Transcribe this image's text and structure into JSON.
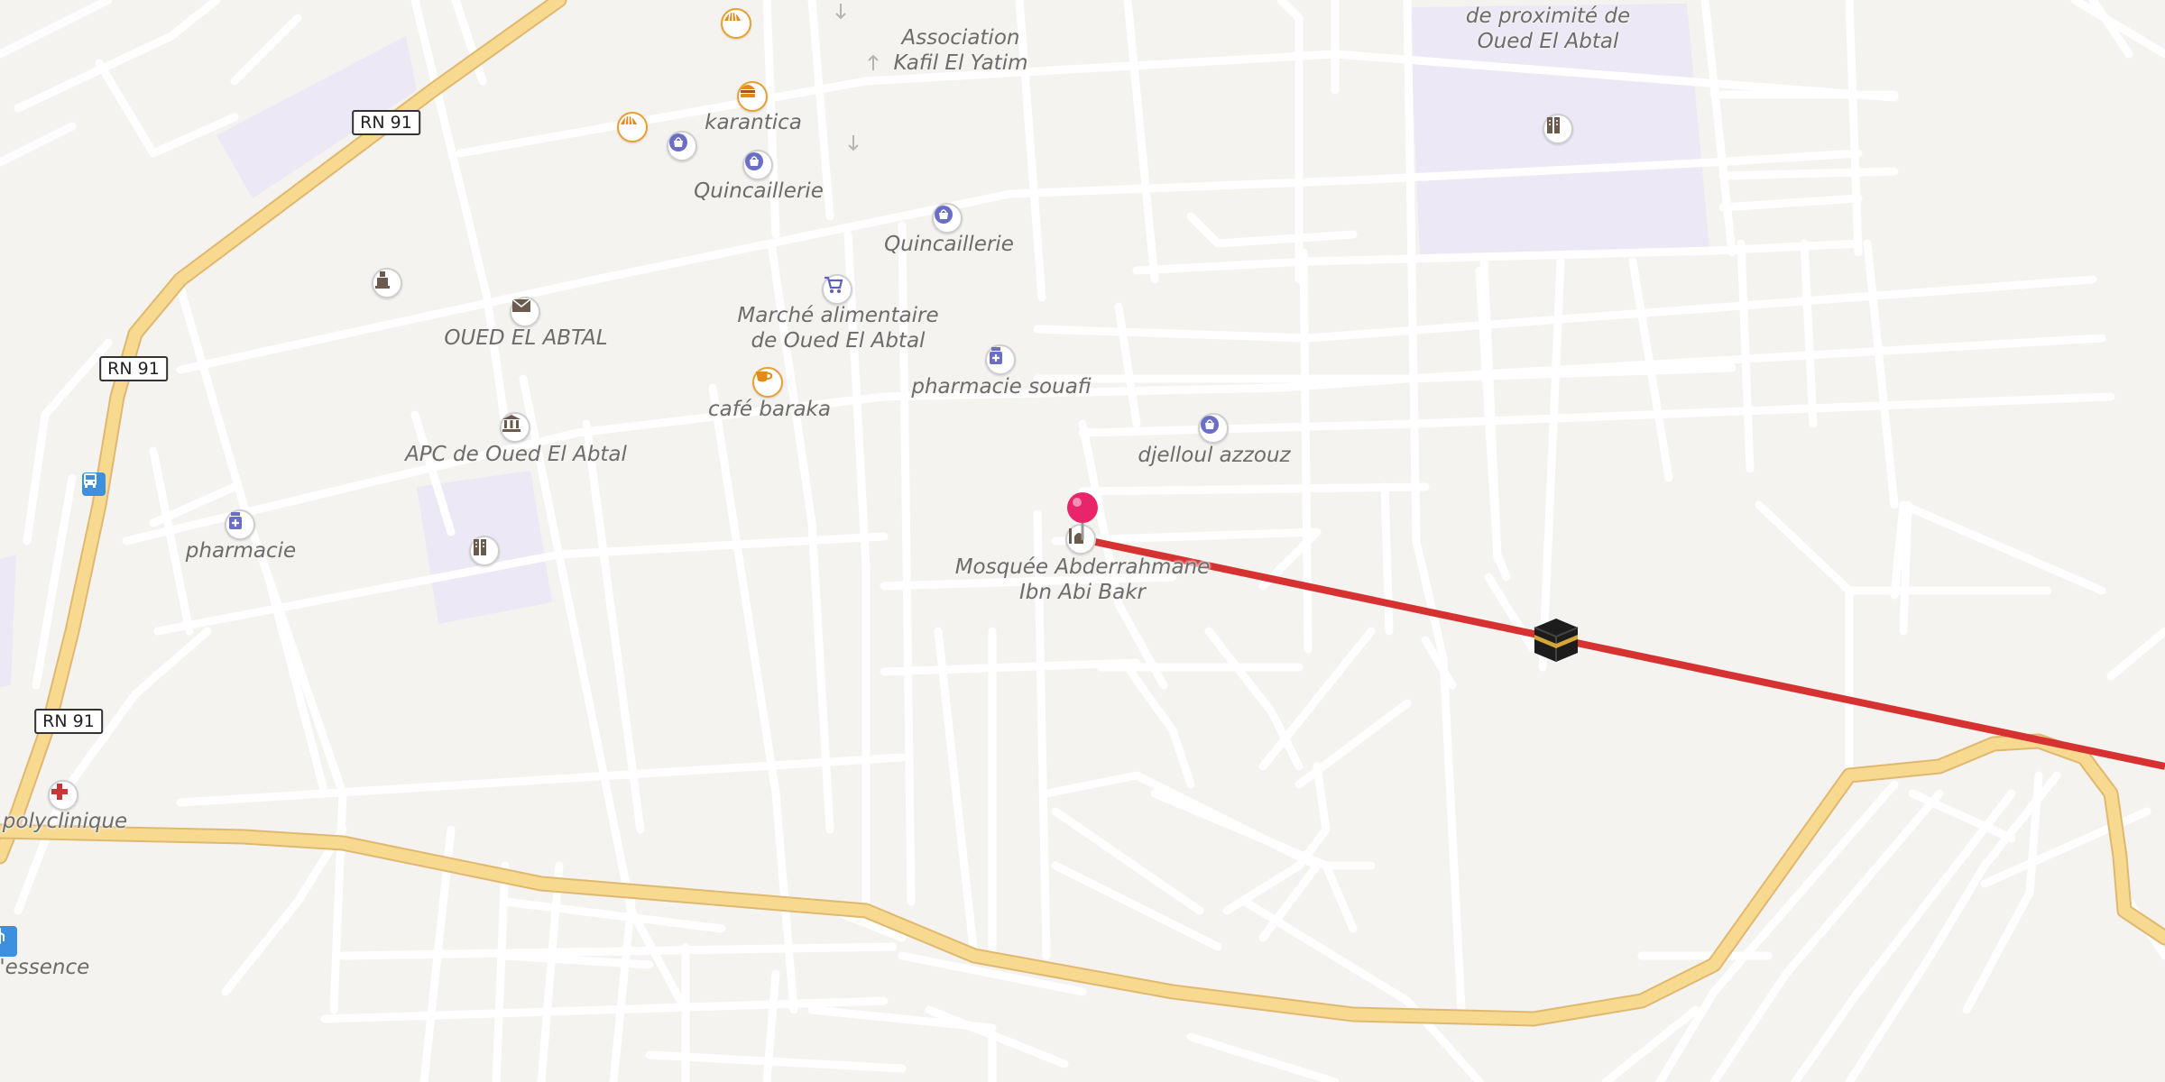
{
  "map": {
    "roads": {
      "shield_rn91": "RN 91"
    },
    "labels": {
      "association": "Association\nKafil El Yatim",
      "school_ne": "de proximité de\nOued El Abtal",
      "karantica": "karantica",
      "quincaillerie_1": "Quincaillerie",
      "quincaillerie_2": "Quincaillerie",
      "oued_el_abtal": "OUED EL ABTAL",
      "marche": "Marché alimentaire\nde Oued El Abtal",
      "cafe": "café baraka",
      "pharmacie_souafi": "pharmacie souafi",
      "djelloul": "djelloul azzouz",
      "apc": "APC de Oued El Abtal",
      "pharmacie": "pharmacie",
      "mosquee": "Mosquée Abderrahmane\nIbn Abi Bakr",
      "polyclinique": "polyclinique",
      "essence": "d'essence"
    },
    "icons": {
      "bakery": "bakery-icon",
      "fastfood": "fast-food-icon",
      "shop": "shopping-bag-icon",
      "supermarket": "shopping-cart-icon",
      "post": "envelope-icon",
      "townhall": "town-hall-icon",
      "cafe": "coffee-cup-icon",
      "pharmacy": "pharmacy-icon",
      "school": "school-icon",
      "mosque": "mosque-icon",
      "hospital": "red-cross-icon",
      "bus": "bus-stop-icon",
      "fuel": "fuel-station-icon",
      "kaaba": "kaaba-icon",
      "pin": "location-pin-icon",
      "monument": "monument-icon"
    },
    "colors": {
      "background": "#f5f3f0",
      "road": "#ffffff",
      "primary_road": "#f7d98f",
      "school_area": "#ece8f5",
      "qibla_line": "#d63232",
      "pin": "#e8256b"
    },
    "qibla": {
      "direction_label": "Qibla direction line towards Kaaba"
    }
  }
}
